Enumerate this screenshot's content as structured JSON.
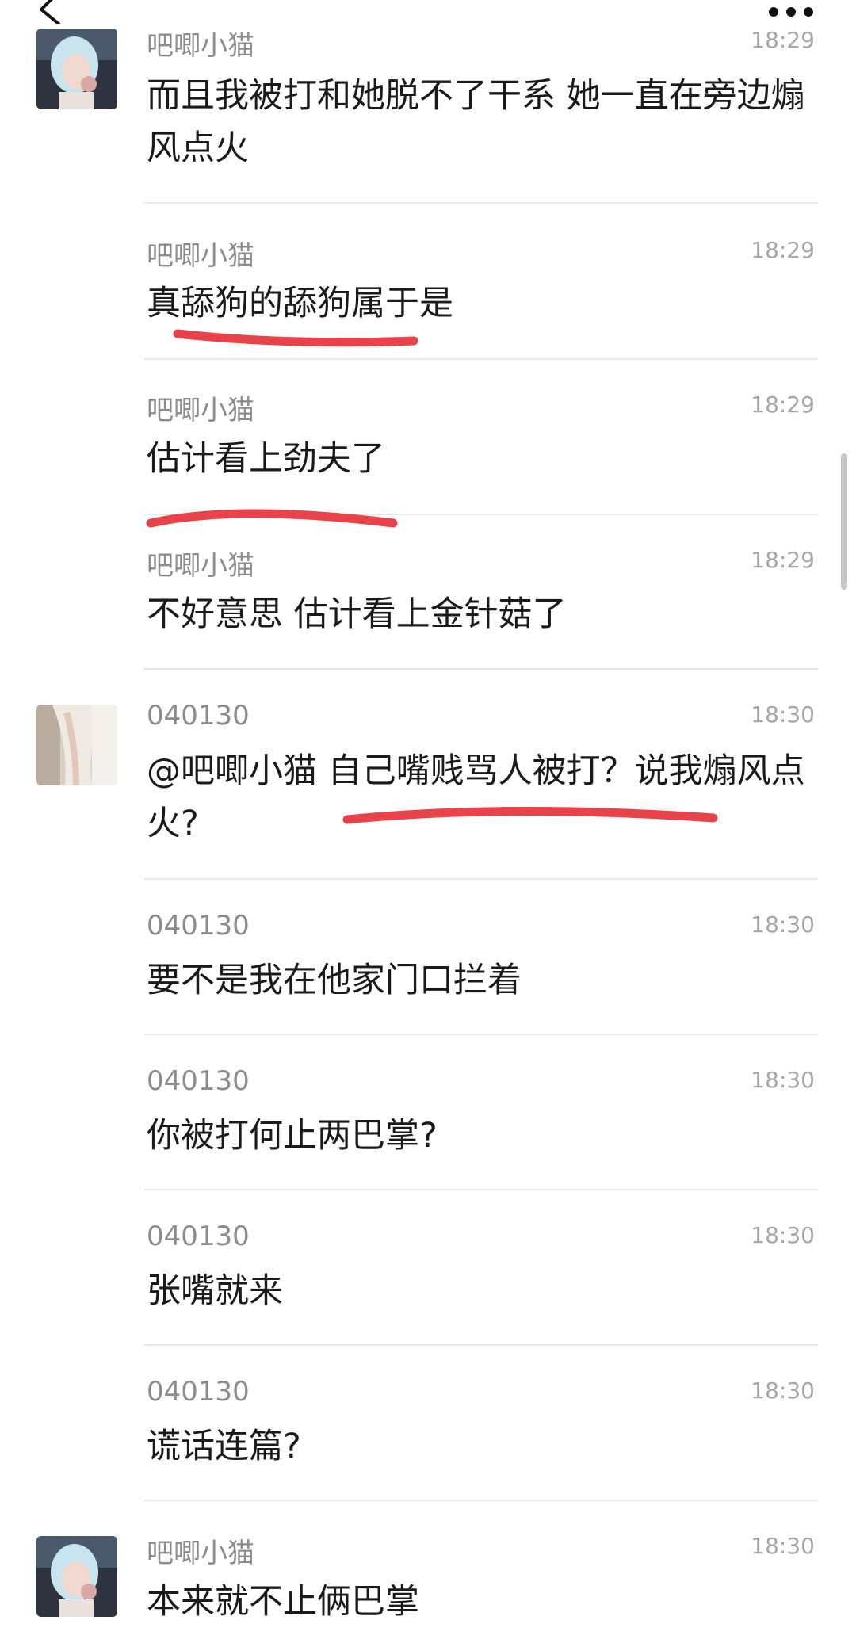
{
  "header": {
    "back_icon": "chevron-left-icon",
    "more_icon": "more-dots-icon"
  },
  "messages": [
    {
      "sender": "吧唧小猫",
      "time": "18:29",
      "text": "而且我被打和她脱不了干系 她一直在旁边煽风点火",
      "avatar": "avatar-blue-hair"
    },
    {
      "sender": "吧唧小猫",
      "time": "18:29",
      "text": "真舔狗的舔狗属于是"
    },
    {
      "sender": "吧唧小猫",
      "time": "18:29",
      "text": "估计看上劲夫了"
    },
    {
      "sender": "吧唧小猫",
      "time": "18:29",
      "text": "不好意思 估计看上金针菇了"
    },
    {
      "sender": "040130",
      "time": "18:30",
      "text": "@吧唧小猫 自己嘴贱骂人被打？说我煽风点火?",
      "avatar": "avatar-white-dress"
    },
    {
      "sender": "040130",
      "time": "18:30",
      "text": "要不是我在他家门口拦着"
    },
    {
      "sender": "040130",
      "time": "18:30",
      "text": "你被打何止两巴掌?"
    },
    {
      "sender": "040130",
      "time": "18:30",
      "text": "张嘴就来"
    },
    {
      "sender": "040130",
      "time": "18:30",
      "text": "谎话连篇?"
    },
    {
      "sender": "吧唧小猫",
      "time": "18:30",
      "text": "本来就不止俩巴掌",
      "avatar": "avatar-blue-hair"
    }
  ],
  "colors": {
    "underline": "#e8424a",
    "sender_gray": "#8c8c8c",
    "time_gray": "#a6a6a6",
    "divider": "#e8e8e8"
  }
}
